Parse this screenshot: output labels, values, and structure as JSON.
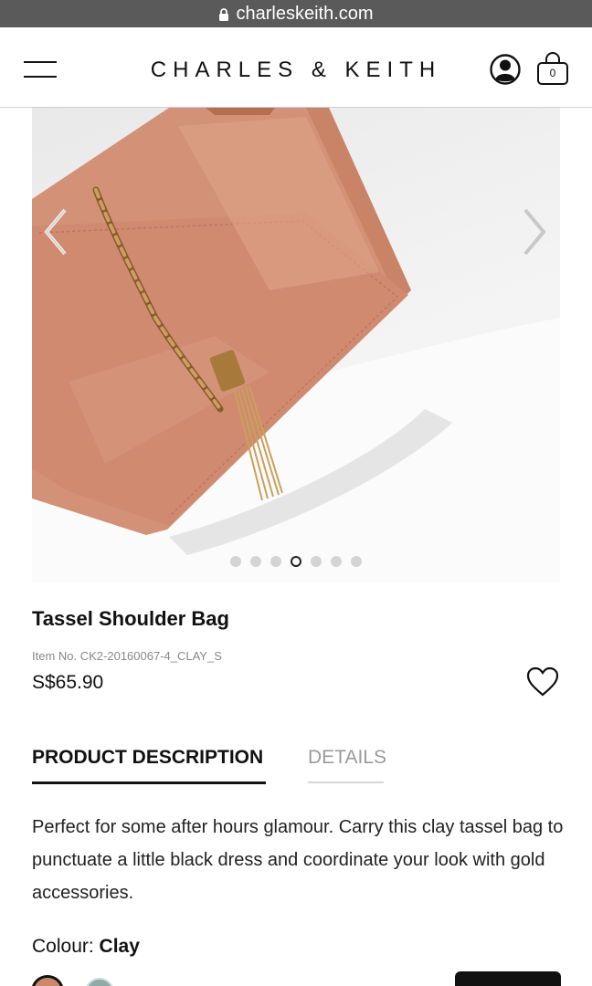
{
  "browser": {
    "url": "charleskeith.com"
  },
  "header": {
    "brand": "CHARLES & KEITH",
    "cart_count": "0"
  },
  "gallery": {
    "slide_count": 7,
    "active_index": 3
  },
  "product": {
    "title": "Tassel Shoulder Bag",
    "item_no": "Item No. CK2-20160067-4_CLAY_S",
    "price": "S$65.90"
  },
  "tabs": [
    {
      "label": "PRODUCT DESCRIPTION",
      "active": true
    },
    {
      "label": "DETAILS",
      "active": false
    }
  ],
  "description": "Perfect for some after hours glamour. Carry this clay tassel bag to punctuate a little black dress and coordinate your look with gold accessories.",
  "colour": {
    "label": "Colour:",
    "value": "Clay",
    "swatches": [
      {
        "name": "Clay",
        "color": "#c98a6b",
        "selected": true
      },
      {
        "name": "Sage",
        "color": "#8faaa8",
        "selected": false
      }
    ]
  },
  "colors": {
    "accent": "#111111",
    "muted": "#9a9a9a",
    "clay": "#d39177"
  }
}
